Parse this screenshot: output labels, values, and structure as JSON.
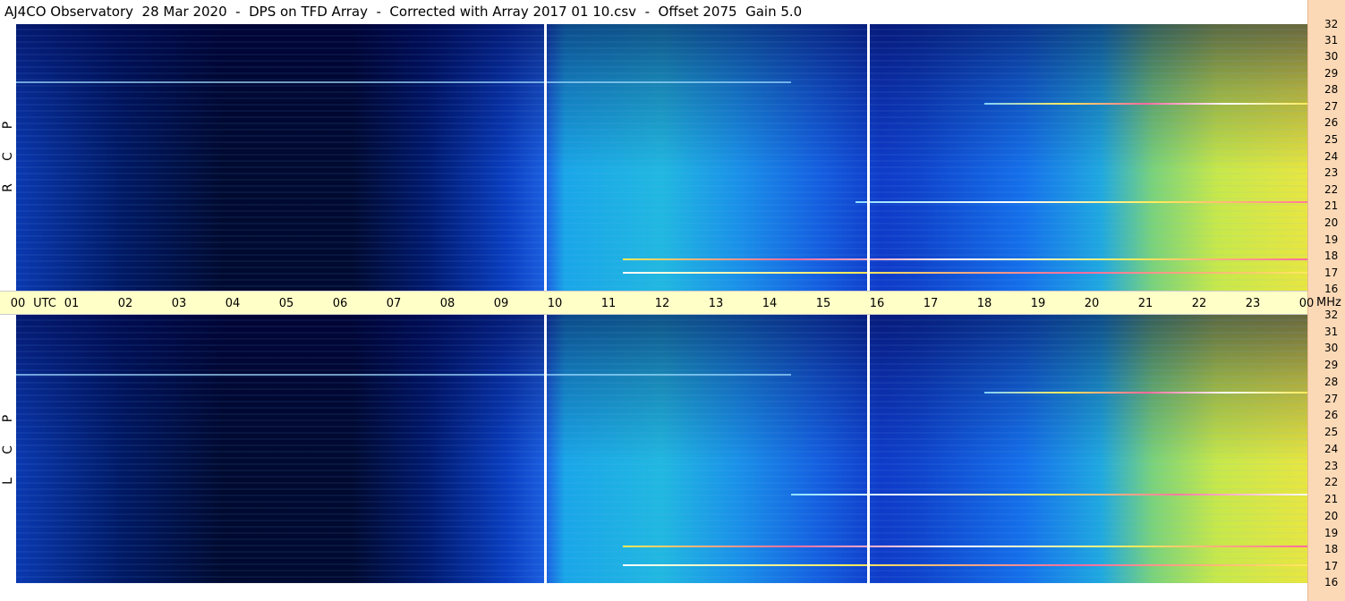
{
  "title": "AJ4CO Observatory  28 Mar 2020  -  DPS on TFD Array  -  Corrected with Array 2017 01 10.csv  -  Offset 2075  Gain 5.0",
  "panels": [
    {
      "name": "upper",
      "polarization": [
        "P",
        "C",
        "R"
      ]
    },
    {
      "name": "lower",
      "polarization": [
        "P",
        "C",
        "L"
      ]
    }
  ],
  "time_axis": {
    "first_label": "00",
    "utc_label": "UTC",
    "hours": [
      "01",
      "02",
      "03",
      "04",
      "05",
      "06",
      "07",
      "08",
      "09",
      "10",
      "11",
      "12",
      "13",
      "14",
      "15",
      "16",
      "17",
      "18",
      "19",
      "20",
      "21",
      "22",
      "23"
    ],
    "last_label": "00",
    "unit_label": "MHz"
  },
  "frequency_axis": {
    "ticks": [
      "32",
      "31",
      "30",
      "29",
      "28",
      "27",
      "26",
      "25",
      "24",
      "23",
      "22",
      "21",
      "20",
      "19",
      "18",
      "17",
      "16"
    ]
  },
  "colors": {
    "background": "#ffffff",
    "axis_bar": "#ffffc8",
    "side_strip": "#fcd9b6"
  }
}
